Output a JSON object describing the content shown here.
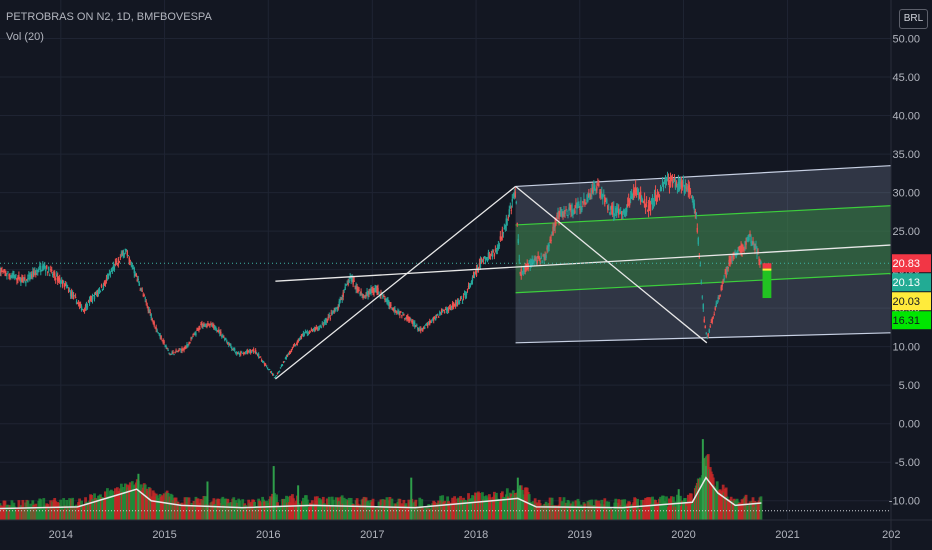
{
  "symbol_title": "PETROBRAS ON N2, 1D, BMFBOVESPA",
  "volume_label": "Vol (20)",
  "currency": "BRL",
  "colors": {
    "background": "#131722",
    "grid": "#1f2433",
    "text": "#b2b5be",
    "candle_up": "#26a69a",
    "candle_down": "#ef5350",
    "volume_ma": "#e8e8e8",
    "trend_line": "#e8e8e8",
    "channel_fill": "#9aa8c6",
    "channel_mid_fill": "#2f7a3a",
    "channel_green": "#3ccf3c"
  },
  "chart_data": {
    "type": "candlestick",
    "title": "PETROBRAS ON N2, 1D, BMFBOVESPA",
    "y_axis": {
      "position": "right",
      "min": -12.5,
      "max": 55,
      "tick_labels": [
        "50.00",
        "45.00",
        "40.00",
        "35.00",
        "30.00",
        "25.00",
        "20.00",
        "15.00",
        "10.00",
        "5.00",
        "0.00",
        "-5.00",
        "-10.00"
      ],
      "tick_values": [
        50,
        45,
        40,
        35,
        30,
        25,
        20,
        15,
        10,
        5,
        0,
        -5,
        -10
      ]
    },
    "x_axis": {
      "start": "2013-06-01",
      "end": "2021-12-31",
      "tick_labels": [
        "2014",
        "2015",
        "2016",
        "2017",
        "2018",
        "2019",
        "2020",
        "2021",
        "202"
      ],
      "tick_dates": [
        "2014-01-01",
        "2015-01-01",
        "2016-01-01",
        "2017-01-01",
        "2018-01-01",
        "2019-01-01",
        "2020-01-01",
        "2021-01-01",
        "2022-01-01"
      ]
    },
    "grid": true,
    "price_path": [
      [
        "2013-06-01",
        19.8
      ],
      [
        "2013-09-01",
        18.5
      ],
      [
        "2013-11-01",
        20.5
      ],
      [
        "2014-01-15",
        18.0
      ],
      [
        "2014-03-20",
        14.8
      ],
      [
        "2014-06-01",
        18.0
      ],
      [
        "2014-08-15",
        22.5
      ],
      [
        "2014-09-15",
        20.0
      ],
      [
        "2014-10-15",
        17.0
      ],
      [
        "2014-12-01",
        12.5
      ],
      [
        "2015-01-20",
        9.0
      ],
      [
        "2015-03-15",
        9.8
      ],
      [
        "2015-05-15",
        13.0
      ],
      [
        "2015-07-01",
        12.5
      ],
      [
        "2015-09-15",
        9.0
      ],
      [
        "2015-11-15",
        9.5
      ],
      [
        "2016-01-26",
        5.9
      ],
      [
        "2016-03-01",
        8.5
      ],
      [
        "2016-05-01",
        11.5
      ],
      [
        "2016-07-01",
        12.5
      ],
      [
        "2016-09-01",
        15.0
      ],
      [
        "2016-10-15",
        19.0
      ],
      [
        "2016-12-01",
        16.5
      ],
      [
        "2017-01-15",
        17.5
      ],
      [
        "2017-03-15",
        15.0
      ],
      [
        "2017-05-15",
        13.5
      ],
      [
        "2017-06-20",
        12.0
      ],
      [
        "2017-09-01",
        14.5
      ],
      [
        "2017-11-15",
        16.0
      ],
      [
        "2018-01-20",
        21.0
      ],
      [
        "2018-03-15",
        22.5
      ],
      [
        "2018-05-20",
        30.0
      ],
      [
        "2018-06-05",
        19.5
      ],
      [
        "2018-07-15",
        21.0
      ],
      [
        "2018-09-01",
        21.5
      ],
      [
        "2018-10-15",
        27.0
      ],
      [
        "2019-01-15",
        28.5
      ],
      [
        "2019-03-01",
        31.0
      ],
      [
        "2019-04-15",
        28.0
      ],
      [
        "2019-06-01",
        27.0
      ],
      [
        "2019-07-15",
        30.5
      ],
      [
        "2019-09-01",
        28.0
      ],
      [
        "2019-11-01",
        31.5
      ],
      [
        "2019-12-15",
        31.0
      ],
      [
        "2020-01-20",
        30.5
      ],
      [
        "2020-02-15",
        27.0
      ],
      [
        "2020-03-15",
        13.0
      ],
      [
        "2020-03-23",
        11.0
      ],
      [
        "2020-05-01",
        16.0
      ],
      [
        "2020-06-15",
        21.5
      ],
      [
        "2020-08-01",
        23.0
      ],
      [
        "2020-08-20",
        24.2
      ],
      [
        "2020-09-15",
        22.5
      ],
      [
        "2020-10-01",
        20.5
      ]
    ],
    "volume_ma_path": [
      [
        "2013-06-01",
        -11.0
      ],
      [
        "2014-03-01",
        -10.8
      ],
      [
        "2014-09-25",
        -8.5
      ],
      [
        "2014-11-15",
        -10.0
      ],
      [
        "2015-03-01",
        -10.6
      ],
      [
        "2015-10-01",
        -10.9
      ],
      [
        "2016-06-01",
        -10.6
      ],
      [
        "2017-06-01",
        -10.9
      ],
      [
        "2018-05-28",
        -9.7
      ],
      [
        "2018-08-01",
        -10.8
      ],
      [
        "2019-06-01",
        -10.9
      ],
      [
        "2020-02-01",
        -10.2
      ],
      [
        "2020-03-20",
        -7.0
      ],
      [
        "2020-05-01",
        -9.0
      ],
      [
        "2020-07-01",
        -10.6
      ],
      [
        "2020-10-01",
        -10.3
      ]
    ],
    "volume_spikes": [
      [
        "2014-10-01",
        -6.5
      ],
      [
        "2015-06-01",
        -7.5
      ],
      [
        "2016-01-20",
        -5.5
      ],
      [
        "2016-04-15",
        -8.0
      ],
      [
        "2017-05-18",
        -7.0
      ],
      [
        "2018-05-28",
        -7.0
      ],
      [
        "2018-06-05",
        -8.0
      ],
      [
        "2019-12-15",
        -8.5
      ],
      [
        "2020-03-09",
        -2.0
      ],
      [
        "2020-03-12",
        -4.5
      ],
      [
        "2020-03-20",
        -5.5
      ],
      [
        "2020-04-15",
        -8.0
      ]
    ],
    "price_axis_badges": [
      {
        "label": "20.83",
        "value": 20.83,
        "color": "#f23645",
        "text_color": "#ffffff"
      },
      {
        "label": "20.13",
        "value": 20.13,
        "color": "#22ab94",
        "text_color": "#ffffff"
      },
      {
        "label": "20.03",
        "value": 20.03,
        "color": "#ffeb3b",
        "text_color": "#131722"
      },
      {
        "label": "16.31",
        "value": 16.31,
        "color": "#00e600",
        "text_color": "#131722"
      }
    ],
    "drawings": {
      "trend_line": {
        "from": [
          "2016-01-26",
          18.5
        ],
        "to": [
          "2021-12-31",
          23.2
        ]
      },
      "v_lines": [
        [
          [
            "2016-01-26",
            5.8
          ],
          [
            "2018-05-20",
            30.8
          ]
        ],
        [
          [
            "2018-05-20",
            30.8
          ],
          [
            "2020-03-23",
            10.5
          ]
        ]
      ],
      "pitchfork": {
        "start": "2018-05-20",
        "end": "2021-12-31",
        "upper": [
          30.8,
          33.5
        ],
        "mid_upper": [
          25.8,
          28.3
        ],
        "mid_lower": [
          17.0,
          19.5
        ],
        "lower": [
          10.5,
          11.8
        ]
      },
      "position_box": {
        "from": "2020-10-05",
        "to": "2020-11-05",
        "entry": 20.13,
        "stop": 20.83,
        "target": 16.31
      },
      "current_price_line": 20.83
    }
  }
}
